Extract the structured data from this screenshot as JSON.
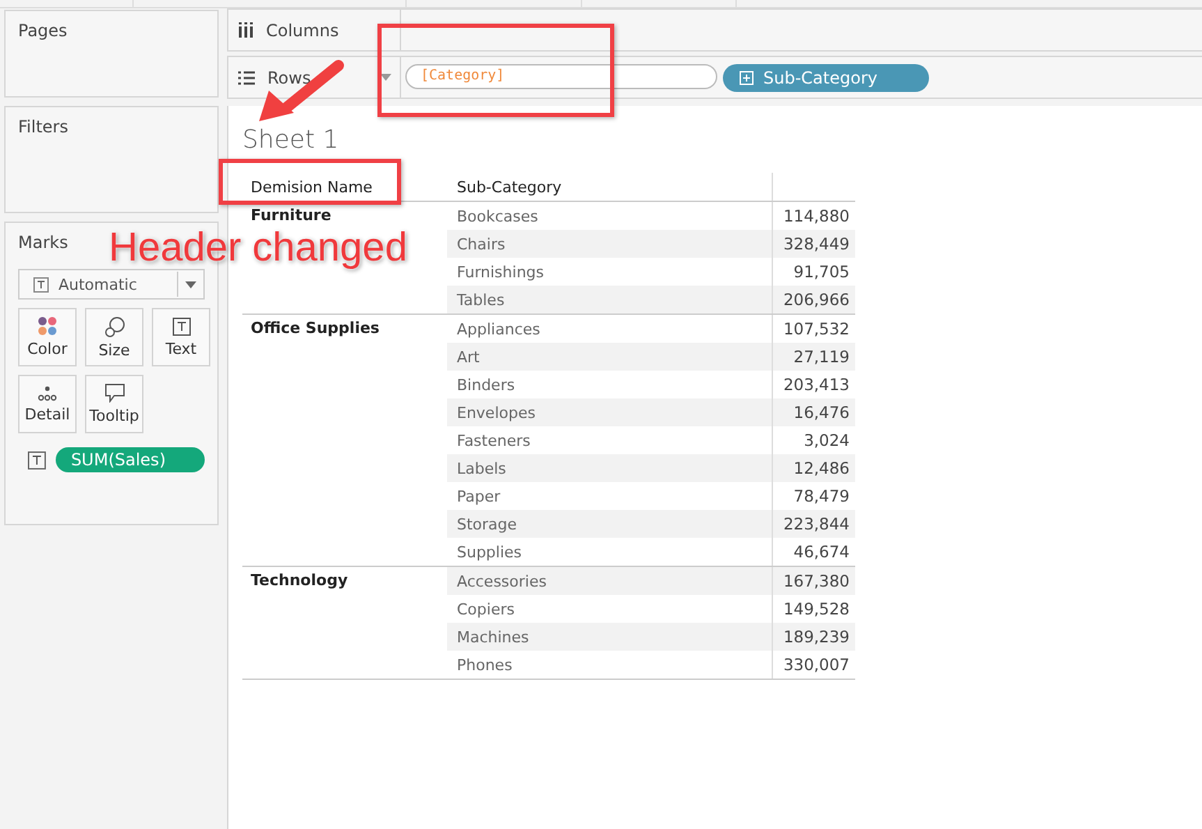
{
  "left_panel": {
    "pages": {
      "title": "Pages"
    },
    "filters": {
      "title": "Filters"
    },
    "marks": {
      "title": "Marks",
      "mark_type": "Automatic",
      "cards": [
        {
          "kind": "color",
          "label": "Color"
        },
        {
          "kind": "size",
          "label": "Size"
        },
        {
          "kind": "text",
          "label": "Text"
        },
        {
          "kind": "detail",
          "label": "Detail"
        },
        {
          "kind": "tooltip",
          "label": "Tooltip"
        }
      ],
      "pill": "SUM(Sales)"
    }
  },
  "shelves": {
    "columns": {
      "label": "Columns"
    },
    "rows": {
      "label": "Rows",
      "pills": [
        {
          "kind": "calc",
          "text": "[Category]"
        },
        {
          "kind": "dimension",
          "text": "Sub-Category"
        }
      ]
    }
  },
  "sheet": {
    "title": "Sheet 1",
    "table": {
      "columns": [
        "Demision Name",
        "Sub-Category"
      ],
      "groups": [
        {
          "category": "Furniture",
          "rows": [
            {
              "name": "Bookcases",
              "value": "114,880"
            },
            {
              "name": "Chairs",
              "value": "328,449"
            },
            {
              "name": "Furnishings",
              "value": "91,705"
            },
            {
              "name": "Tables",
              "value": "206,966"
            }
          ]
        },
        {
          "category": "Office Supplies",
          "rows": [
            {
              "name": "Appliances",
              "value": "107,532"
            },
            {
              "name": "Art",
              "value": "27,119"
            },
            {
              "name": "Binders",
              "value": "203,413"
            },
            {
              "name": "Envelopes",
              "value": "16,476"
            },
            {
              "name": "Fasteners",
              "value": "3,024"
            },
            {
              "name": "Labels",
              "value": "12,486"
            },
            {
              "name": "Paper",
              "value": "78,479"
            },
            {
              "name": "Storage",
              "value": "223,844"
            },
            {
              "name": "Supplies",
              "value": "46,674"
            }
          ]
        },
        {
          "category": "Technology",
          "rows": [
            {
              "name": "Accessories",
              "value": "167,380"
            },
            {
              "name": "Copiers",
              "value": "149,528"
            },
            {
              "name": "Machines",
              "value": "189,239"
            },
            {
              "name": "Phones",
              "value": "330,007"
            }
          ]
        }
      ]
    }
  },
  "annotation": {
    "text": "Header changed"
  }
}
